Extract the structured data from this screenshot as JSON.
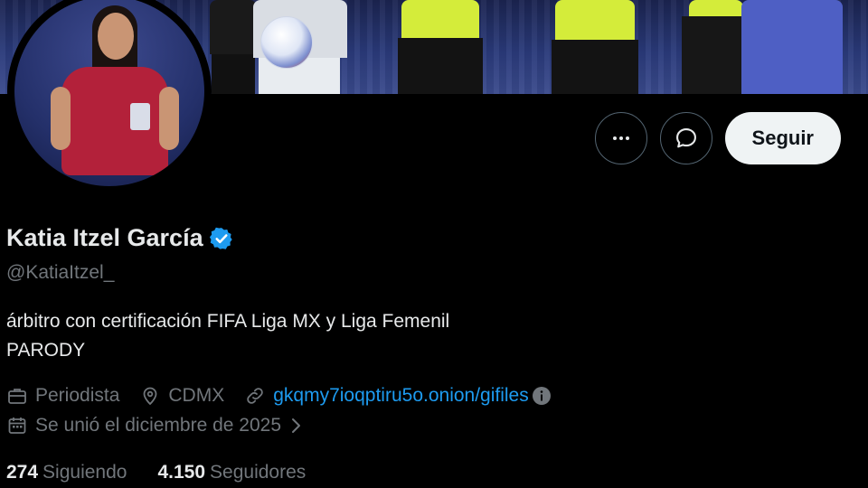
{
  "profile": {
    "name": "Katia Itzel García",
    "handle": "@KatiaItzel_",
    "bio_line1": "árbitro con certificación FIFA Liga MX y Liga Femenil",
    "bio_line2": "PARODY",
    "occupation": "Periodista",
    "location": "CDMX",
    "link": "gkqmy7ioqptiru5o.onion/gifiles",
    "joined": "Se unió el diciembre de 2025",
    "following_count": "274",
    "following_label": "Siguiendo",
    "followers_count": "4.150",
    "followers_label": "Seguidores"
  },
  "actions": {
    "follow_label": "Seguir"
  },
  "colors": {
    "background": "#000000",
    "text_primary": "#e7e9ea",
    "text_secondary": "#71767b",
    "link": "#1d9bf0",
    "verified": "#1d9bf0",
    "follow_button_bg": "#eff3f4"
  },
  "icons": {
    "more": "more-icon",
    "message": "message-icon",
    "verified": "verified-badge-icon",
    "occupation": "briefcase-icon",
    "location": "location-pin-icon",
    "link": "link-icon",
    "info": "info-icon",
    "calendar": "calendar-icon",
    "chevron": "chevron-right-icon"
  }
}
